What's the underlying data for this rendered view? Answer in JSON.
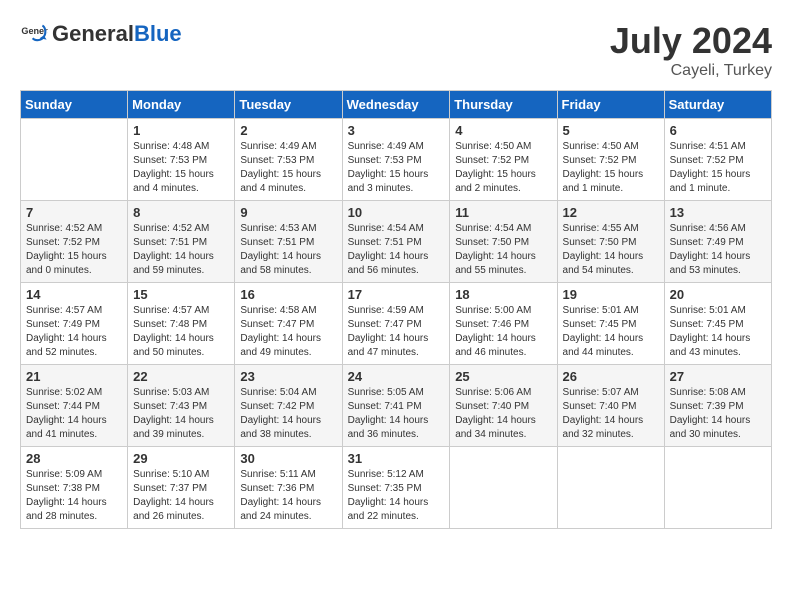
{
  "header": {
    "logo_general": "General",
    "logo_blue": "Blue",
    "month_year": "July 2024",
    "location": "Cayeli, Turkey"
  },
  "days_of_week": [
    "Sunday",
    "Monday",
    "Tuesday",
    "Wednesday",
    "Thursday",
    "Friday",
    "Saturday"
  ],
  "weeks": [
    [
      {
        "day": "",
        "sunrise": "",
        "sunset": "",
        "daylight": ""
      },
      {
        "day": "1",
        "sunrise": "Sunrise: 4:48 AM",
        "sunset": "Sunset: 7:53 PM",
        "daylight": "Daylight: 15 hours and 4 minutes."
      },
      {
        "day": "2",
        "sunrise": "Sunrise: 4:49 AM",
        "sunset": "Sunset: 7:53 PM",
        "daylight": "Daylight: 15 hours and 4 minutes."
      },
      {
        "day": "3",
        "sunrise": "Sunrise: 4:49 AM",
        "sunset": "Sunset: 7:53 PM",
        "daylight": "Daylight: 15 hours and 3 minutes."
      },
      {
        "day": "4",
        "sunrise": "Sunrise: 4:50 AM",
        "sunset": "Sunset: 7:52 PM",
        "daylight": "Daylight: 15 hours and 2 minutes."
      },
      {
        "day": "5",
        "sunrise": "Sunrise: 4:50 AM",
        "sunset": "Sunset: 7:52 PM",
        "daylight": "Daylight: 15 hours and 1 minute."
      },
      {
        "day": "6",
        "sunrise": "Sunrise: 4:51 AM",
        "sunset": "Sunset: 7:52 PM",
        "daylight": "Daylight: 15 hours and 1 minute."
      }
    ],
    [
      {
        "day": "7",
        "sunrise": "Sunrise: 4:52 AM",
        "sunset": "Sunset: 7:52 PM",
        "daylight": "Daylight: 15 hours and 0 minutes."
      },
      {
        "day": "8",
        "sunrise": "Sunrise: 4:52 AM",
        "sunset": "Sunset: 7:51 PM",
        "daylight": "Daylight: 14 hours and 59 minutes."
      },
      {
        "day": "9",
        "sunrise": "Sunrise: 4:53 AM",
        "sunset": "Sunset: 7:51 PM",
        "daylight": "Daylight: 14 hours and 58 minutes."
      },
      {
        "day": "10",
        "sunrise": "Sunrise: 4:54 AM",
        "sunset": "Sunset: 7:51 PM",
        "daylight": "Daylight: 14 hours and 56 minutes."
      },
      {
        "day": "11",
        "sunrise": "Sunrise: 4:54 AM",
        "sunset": "Sunset: 7:50 PM",
        "daylight": "Daylight: 14 hours and 55 minutes."
      },
      {
        "day": "12",
        "sunrise": "Sunrise: 4:55 AM",
        "sunset": "Sunset: 7:50 PM",
        "daylight": "Daylight: 14 hours and 54 minutes."
      },
      {
        "day": "13",
        "sunrise": "Sunrise: 4:56 AM",
        "sunset": "Sunset: 7:49 PM",
        "daylight": "Daylight: 14 hours and 53 minutes."
      }
    ],
    [
      {
        "day": "14",
        "sunrise": "Sunrise: 4:57 AM",
        "sunset": "Sunset: 7:49 PM",
        "daylight": "Daylight: 14 hours and 52 minutes."
      },
      {
        "day": "15",
        "sunrise": "Sunrise: 4:57 AM",
        "sunset": "Sunset: 7:48 PM",
        "daylight": "Daylight: 14 hours and 50 minutes."
      },
      {
        "day": "16",
        "sunrise": "Sunrise: 4:58 AM",
        "sunset": "Sunset: 7:47 PM",
        "daylight": "Daylight: 14 hours and 49 minutes."
      },
      {
        "day": "17",
        "sunrise": "Sunrise: 4:59 AM",
        "sunset": "Sunset: 7:47 PM",
        "daylight": "Daylight: 14 hours and 47 minutes."
      },
      {
        "day": "18",
        "sunrise": "Sunrise: 5:00 AM",
        "sunset": "Sunset: 7:46 PM",
        "daylight": "Daylight: 14 hours and 46 minutes."
      },
      {
        "day": "19",
        "sunrise": "Sunrise: 5:01 AM",
        "sunset": "Sunset: 7:45 PM",
        "daylight": "Daylight: 14 hours and 44 minutes."
      },
      {
        "day": "20",
        "sunrise": "Sunrise: 5:01 AM",
        "sunset": "Sunset: 7:45 PM",
        "daylight": "Daylight: 14 hours and 43 minutes."
      }
    ],
    [
      {
        "day": "21",
        "sunrise": "Sunrise: 5:02 AM",
        "sunset": "Sunset: 7:44 PM",
        "daylight": "Daylight: 14 hours and 41 minutes."
      },
      {
        "day": "22",
        "sunrise": "Sunrise: 5:03 AM",
        "sunset": "Sunset: 7:43 PM",
        "daylight": "Daylight: 14 hours and 39 minutes."
      },
      {
        "day": "23",
        "sunrise": "Sunrise: 5:04 AM",
        "sunset": "Sunset: 7:42 PM",
        "daylight": "Daylight: 14 hours and 38 minutes."
      },
      {
        "day": "24",
        "sunrise": "Sunrise: 5:05 AM",
        "sunset": "Sunset: 7:41 PM",
        "daylight": "Daylight: 14 hours and 36 minutes."
      },
      {
        "day": "25",
        "sunrise": "Sunrise: 5:06 AM",
        "sunset": "Sunset: 7:40 PM",
        "daylight": "Daylight: 14 hours and 34 minutes."
      },
      {
        "day": "26",
        "sunrise": "Sunrise: 5:07 AM",
        "sunset": "Sunset: 7:40 PM",
        "daylight": "Daylight: 14 hours and 32 minutes."
      },
      {
        "day": "27",
        "sunrise": "Sunrise: 5:08 AM",
        "sunset": "Sunset: 7:39 PM",
        "daylight": "Daylight: 14 hours and 30 minutes."
      }
    ],
    [
      {
        "day": "28",
        "sunrise": "Sunrise: 5:09 AM",
        "sunset": "Sunset: 7:38 PM",
        "daylight": "Daylight: 14 hours and 28 minutes."
      },
      {
        "day": "29",
        "sunrise": "Sunrise: 5:10 AM",
        "sunset": "Sunset: 7:37 PM",
        "daylight": "Daylight: 14 hours and 26 minutes."
      },
      {
        "day": "30",
        "sunrise": "Sunrise: 5:11 AM",
        "sunset": "Sunset: 7:36 PM",
        "daylight": "Daylight: 14 hours and 24 minutes."
      },
      {
        "day": "31",
        "sunrise": "Sunrise: 5:12 AM",
        "sunset": "Sunset: 7:35 PM",
        "daylight": "Daylight: 14 hours and 22 minutes."
      },
      {
        "day": "",
        "sunrise": "",
        "sunset": "",
        "daylight": ""
      },
      {
        "day": "",
        "sunrise": "",
        "sunset": "",
        "daylight": ""
      },
      {
        "day": "",
        "sunrise": "",
        "sunset": "",
        "daylight": ""
      }
    ]
  ]
}
